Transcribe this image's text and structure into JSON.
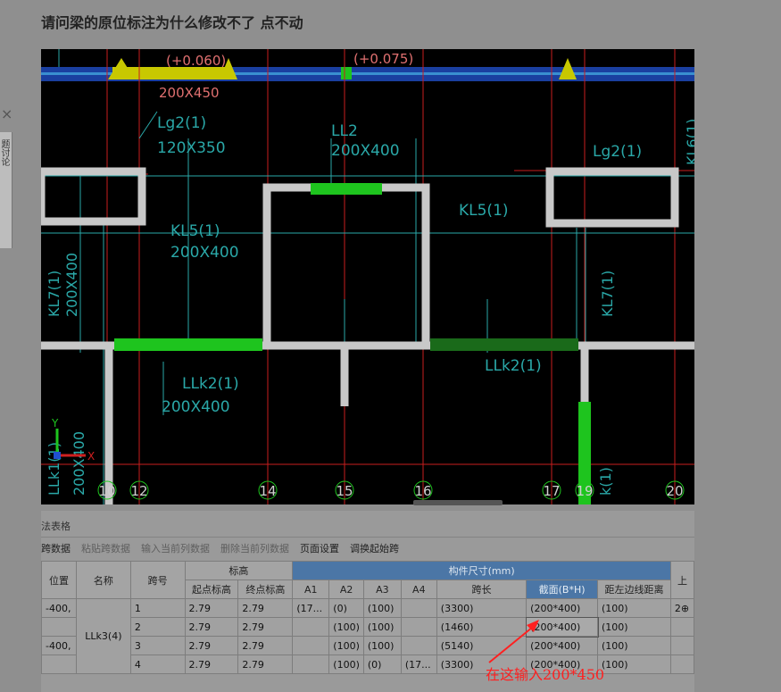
{
  "post": {
    "title": "请问梁的原位标注为什么修改不了 点不动"
  },
  "side": {
    "tab_text": "题讨论",
    "close_glyph": "×"
  },
  "cad": {
    "elevations": [
      "(+0.060)",
      "(+0.075)"
    ],
    "beam_labels": {
      "top_size": "200X450",
      "lg2_a": "Lg2(1)",
      "lg2_a_size": "120X350",
      "ll2": "LL2",
      "ll2_size": "200X400",
      "lg2_b": "Lg2(1)",
      "kl5_a": "KL5(1)",
      "kl5_a_size": "200X400",
      "kl5_b": "KL5(1)",
      "kl7_a": "KL7(1)",
      "kl7_a_size": "200X400",
      "kl7_b": "KL7(1)",
      "kl6": "KL6(1)",
      "llk2_a": "LLk2(1)",
      "llk2_a_size": "200X400",
      "llk2_b": "LLk2(1)",
      "llk1": "LLk1(1)",
      "llk1_size": "200X400",
      "k_right": "k(1)"
    },
    "axis_numbers": [
      "10",
      "12",
      "14",
      "15",
      "16",
      "17",
      "19",
      "20"
    ],
    "ucs": {
      "y": "Y",
      "x": "X"
    },
    "colors": {
      "beam_green": "#1ec41e",
      "axis_red": "#c81e1e",
      "cad_cyan": "#2aa8a8",
      "label_pink": "#e07070"
    }
  },
  "panel": {
    "title": "法表格",
    "toolbar": [
      "跨数据",
      "粘贴跨数据",
      "输入当前列数据",
      "删除当前列数据",
      "页面设置",
      "调换起始跨"
    ],
    "toolbar_disabled": [
      false,
      true,
      true,
      true,
      false,
      false
    ],
    "headers": {
      "position": "位置",
      "name": "名称",
      "span_no": "跨号",
      "elevation": "标高",
      "start_elev": "起点标高",
      "end_elev": "终点标高",
      "dims": "构件尺寸(mm)",
      "a1": "A1",
      "a2": "A2",
      "a3": "A3",
      "a4": "A4",
      "span_len": "跨长",
      "section": "截面(B*H)",
      "left_dist": "距左边线距离",
      "extra": "上"
    },
    "rows": [
      {
        "pos": "-400,",
        "span": "1",
        "start": "2.79",
        "end": "2.79",
        "a1": "(17...",
        "a2": "(0)",
        "a3": "(100)",
        "a4": "",
        "len": "(3300)",
        "section": "(200*400)",
        "dist": "(100)",
        "extra": "2⊕"
      },
      {
        "pos": "",
        "span": "2",
        "start": "2.79",
        "end": "2.79",
        "a1": "",
        "a2": "(100)",
        "a3": "(100)",
        "a4": "",
        "len": "(1460)",
        "section": "(200*400)",
        "dist": "(100)",
        "extra": ""
      },
      {
        "pos": "-400,",
        "span": "3",
        "start": "2.79",
        "end": "2.79",
        "a1": "",
        "a2": "(100)",
        "a3": "(100)",
        "a4": "",
        "len": "(5140)",
        "section": "(200*400)",
        "dist": "(100)",
        "extra": ""
      },
      {
        "pos": "",
        "span": "4",
        "start": "2.79",
        "end": "2.79",
        "a1": "",
        "a2": "(100)",
        "a3": "(0)",
        "a4": "(17...",
        "len": "(3300)",
        "section": "(200*400)",
        "dist": "(100)",
        "extra": ""
      }
    ],
    "beam_name": "LLk3(4)"
  },
  "annotation": {
    "text": "在这输入200*450",
    "color": "#ff2020"
  }
}
